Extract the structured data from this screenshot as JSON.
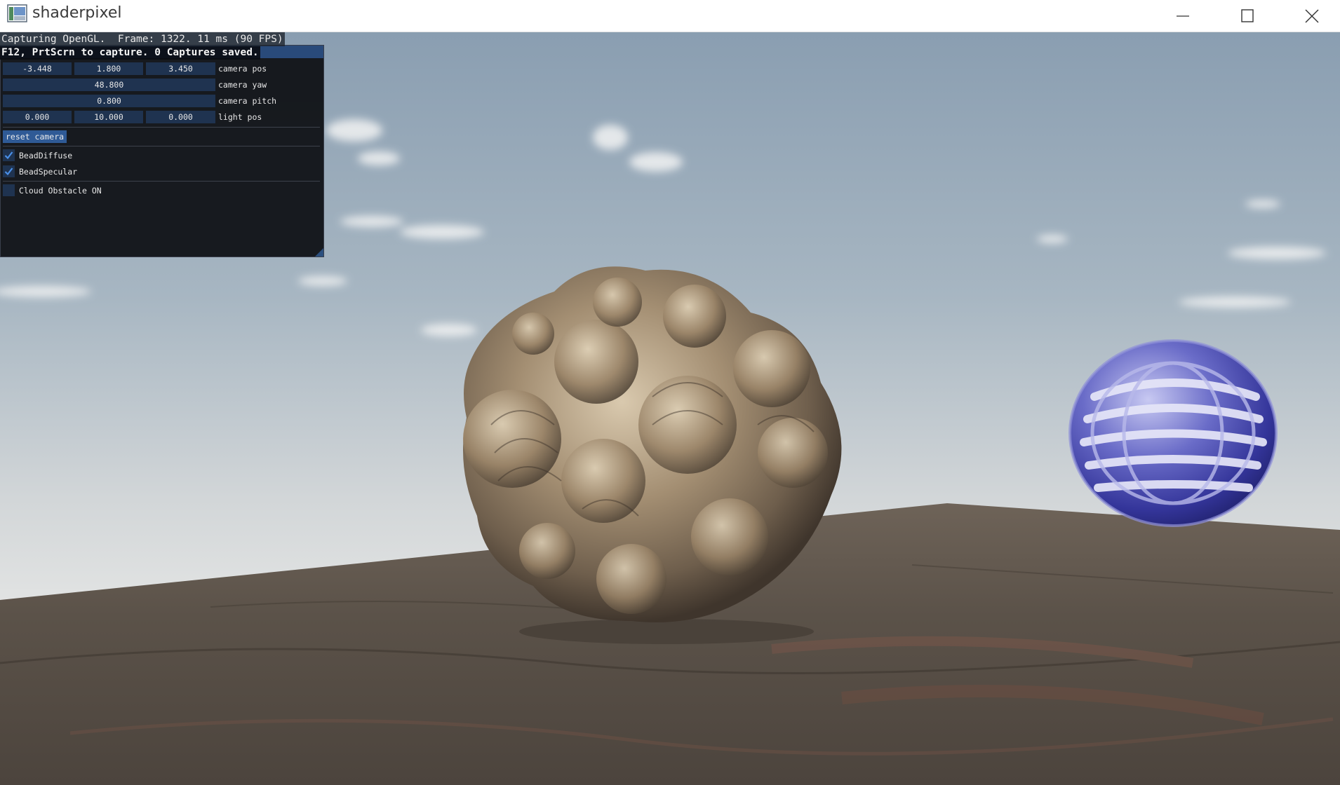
{
  "window": {
    "title": "shaderpixel",
    "icon": "app-icon",
    "controls": [
      "minimize-icon",
      "maximize-icon",
      "close-icon"
    ]
  },
  "overlay": {
    "capture_status": "Capturing OpenGL.  Frame: 1322. 11 ms (90 FPS)",
    "capture_hint": "F12, PrtScrn to capture. 0 Captures saved."
  },
  "panel": {
    "camera_pos": {
      "x": "-3.448",
      "y": "1.800",
      "z": "3.450",
      "label": "camera pos"
    },
    "camera_yaw": {
      "value": "48.800",
      "label": "camera yaw"
    },
    "camera_pitch": {
      "value": "0.800",
      "label": "camera pitch"
    },
    "light_pos": {
      "x": "0.000",
      "y": "10.000",
      "z": "0.000",
      "label": "light pos"
    },
    "reset_label": "reset camera",
    "checkboxes": [
      {
        "label": "BeadDiffuse",
        "checked": true
      },
      {
        "label": "BeadSpecular",
        "checked": true
      },
      {
        "label": "Cloud Obstacle ON",
        "checked": false
      }
    ]
  },
  "colors": {
    "panel_bg": "#101216",
    "panel_title": "#294a7a",
    "field_bg": "#1f3350",
    "button_bg": "#2f5a96",
    "check_mark": "#4a90e8",
    "sky_top": "#8ea2b4",
    "sky_horizon": "#dfe2e3",
    "ground": "#5a5147",
    "fractal": "#a08c72",
    "orb": "#3f40a8"
  }
}
